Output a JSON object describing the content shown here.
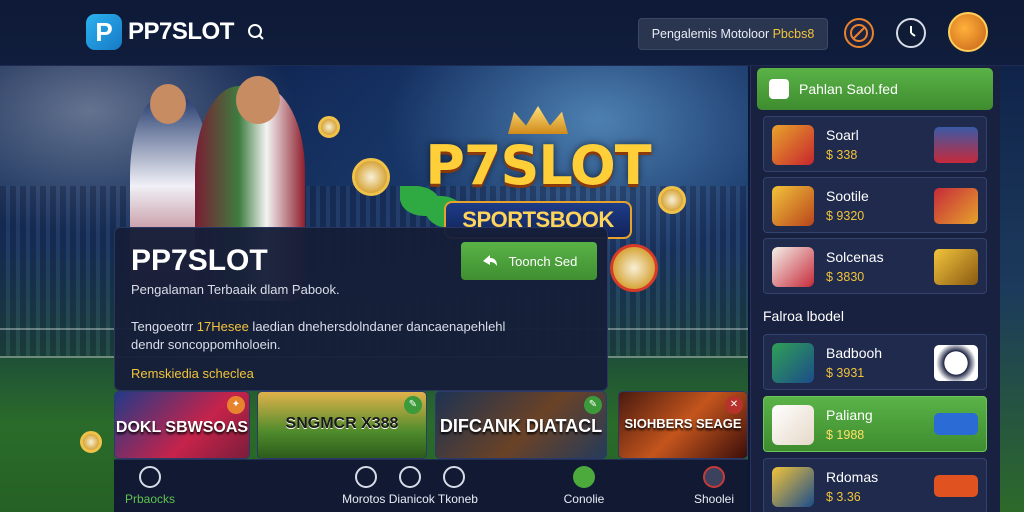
{
  "header": {
    "logo_letter": "P",
    "logo_text": "PP7SLOT",
    "pill_text_main": "Pengalemis Motoloor ",
    "pill_text_accent": "Pbcbs8"
  },
  "hero": {
    "title": "P7SLOT",
    "subtitle": "SPORTSBOOK"
  },
  "info_card": {
    "title": "PP7SLOT",
    "subtitle": "Pengalaman Terbaaik dlam Pabook.",
    "desc_prefix": "Tengoeotrr ",
    "desc_accent": "17Hesee",
    "desc_rest": " laedian dnehersdolndaner dancaenapehlehl dendr soncoppomholoein.",
    "link": "Remskiedia scheclea",
    "button_label": "Toonch Sed"
  },
  "thumbnails": [
    {
      "label": "DOKL SBWSOAS"
    },
    {
      "label": "SNGMCR X388"
    },
    {
      "label": "DIFCANK DIATACL"
    },
    {
      "label": "SIOHBERS SEAGE"
    }
  ],
  "bottom_nav": {
    "promo": "Prbaocks",
    "middle": "Morotos Dianicok Tkoneb",
    "combo": "Conolie",
    "settings": "Shoolei"
  },
  "sidebar": {
    "header": "Pahlan Saol.fed",
    "section_title": "Falroa lbodel",
    "items_top": [
      {
        "name": "Soarl",
        "price": "$ 338"
      },
      {
        "name": "Sootile",
        "price": "$ 9320"
      },
      {
        "name": "Solcenas",
        "price": "$ 3830"
      }
    ],
    "items_bottom": [
      {
        "name": "Badbooh",
        "price": "$ 3931"
      },
      {
        "name": "Paliang",
        "price": "$ 1988"
      },
      {
        "name": "Rdomas",
        "price": "$ 3.36"
      }
    ]
  }
}
